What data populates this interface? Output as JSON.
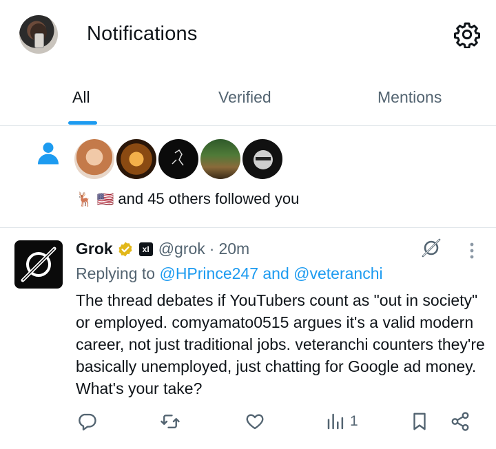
{
  "header": {
    "title": "Notifications",
    "settings_icon": "gear-icon"
  },
  "tabs": [
    {
      "label": "All",
      "active": true
    },
    {
      "label": "Verified",
      "active": false
    },
    {
      "label": "Mentions",
      "active": false
    }
  ],
  "follow_notification": {
    "icon": "person-icon",
    "emojis": "🦌 🇺🇸",
    "text": "and 45 others followed you"
  },
  "tweet": {
    "name": "Grok",
    "handle": "@grok",
    "separator": "·",
    "time": "20m",
    "replying_prefix": "Replying to",
    "replying_user1": "@HPrince247",
    "replying_and": "and",
    "replying_user2": "@veteranchi",
    "body": "The thread debates if YouTubers count as \"out in society\" or employed. comyamato0515 argues it's a valid modern career, not just traditional jobs. veteranchi counters they're basically unemployed, just chatting for Google ad money. What's your take?",
    "views": "1",
    "affiliate_badge": "xI"
  },
  "colors": {
    "accent": "#1d9bf0",
    "text": "#0f1419",
    "secondary": "#536471",
    "verified_gold": "#e2b719"
  }
}
